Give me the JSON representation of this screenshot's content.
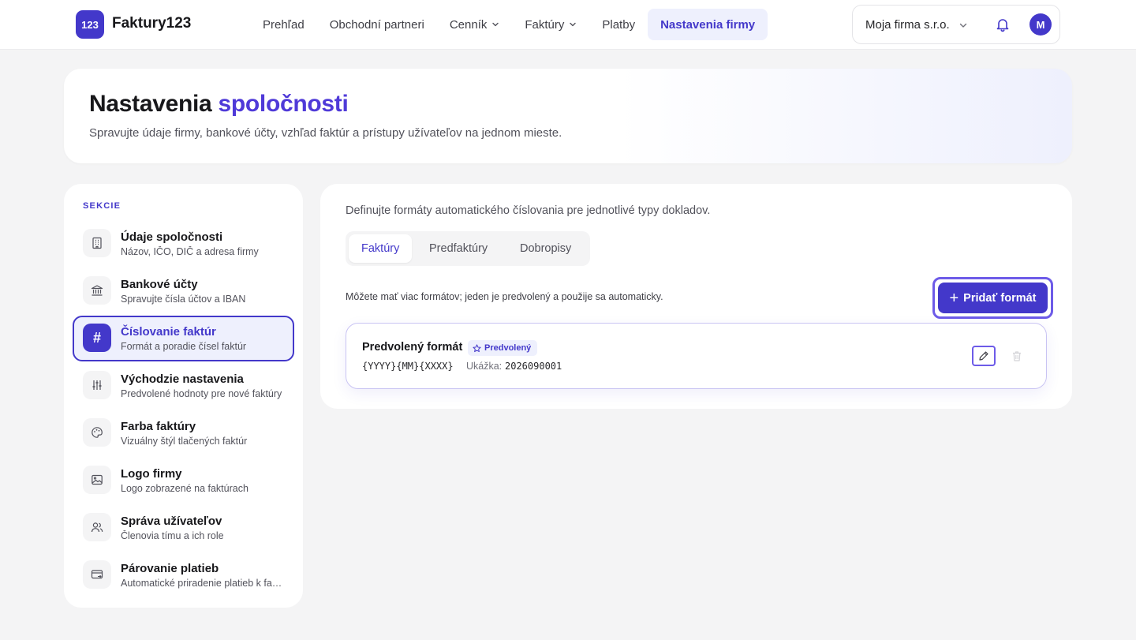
{
  "app": {
    "logo_badge": "123",
    "name": "Faktury123"
  },
  "nav": {
    "items": [
      {
        "label": "Prehľad"
      },
      {
        "label": "Obchodní partneri"
      },
      {
        "label": "Cenník"
      },
      {
        "label": "Faktúry"
      },
      {
        "label": "Platby"
      },
      {
        "label": "Nastavenia firmy"
      }
    ],
    "active": "Nastavenia firmy"
  },
  "account": {
    "firm": "Moja firma s.r.o.",
    "avatar_initial": "M"
  },
  "hero": {
    "title_plain": "Nastavenia",
    "title_accent": "spoločnosti",
    "subtitle": "Spravujte údaje firmy, bankové účty, vzhľad faktúr a prístupy užívateľov na jednom mieste."
  },
  "sidebar": {
    "section_label": "SEKCIE",
    "items": [
      {
        "title": "Údaje spoločnosti",
        "subtitle": "Názov, IČO, DIČ a adresa firmy",
        "icon": "building-icon"
      },
      {
        "title": "Bankové účty",
        "subtitle": "Spravujte čísla účtov a IBAN",
        "icon": "bank-icon"
      },
      {
        "title": "Číslovanie faktúr",
        "subtitle": "Formát a poradie čísel faktúr",
        "icon": "hash-icon",
        "glyph": "#"
      },
      {
        "title": "Východzie nastavenia",
        "subtitle": "Predvolené hodnoty pre nové faktúry",
        "icon": "sliders-icon"
      },
      {
        "title": "Farba faktúry",
        "subtitle": "Vizuálny štýl tlačených faktúr",
        "icon": "palette-icon"
      },
      {
        "title": "Logo firmy",
        "subtitle": "Logo zobrazené na faktúrach",
        "icon": "image-icon"
      },
      {
        "title": "Správa užívateľov",
        "subtitle": "Členovia tímu a ich role",
        "icon": "users-icon"
      },
      {
        "title": "Párovanie platieb",
        "subtitle": "Automatické priradenie platieb k faktúram",
        "icon": "card-transfer-icon"
      }
    ],
    "active_index": 2
  },
  "main": {
    "description": "Definujte formáty automatického číslovania pre jednotlivé typy dokladov.",
    "tabs": [
      {
        "label": "Faktúry"
      },
      {
        "label": "Predfaktúry"
      },
      {
        "label": "Dobropisy"
      }
    ],
    "active_tab": "Faktúry",
    "hint": "Môžete mať viac formátov; jeden je predvolený a použije sa automaticky.",
    "add_button": "Pridať formát",
    "formats": [
      {
        "title": "Predvolený formát",
        "badge": "Predvolený",
        "pattern": "{YYYY}{MM}{XXXX}",
        "sample_label": "Ukážka:",
        "sample": "2026090001"
      }
    ]
  },
  "colors": {
    "accent": "#4338ca",
    "accent_light": "#eef0fd",
    "background": "#f4f4f5"
  }
}
